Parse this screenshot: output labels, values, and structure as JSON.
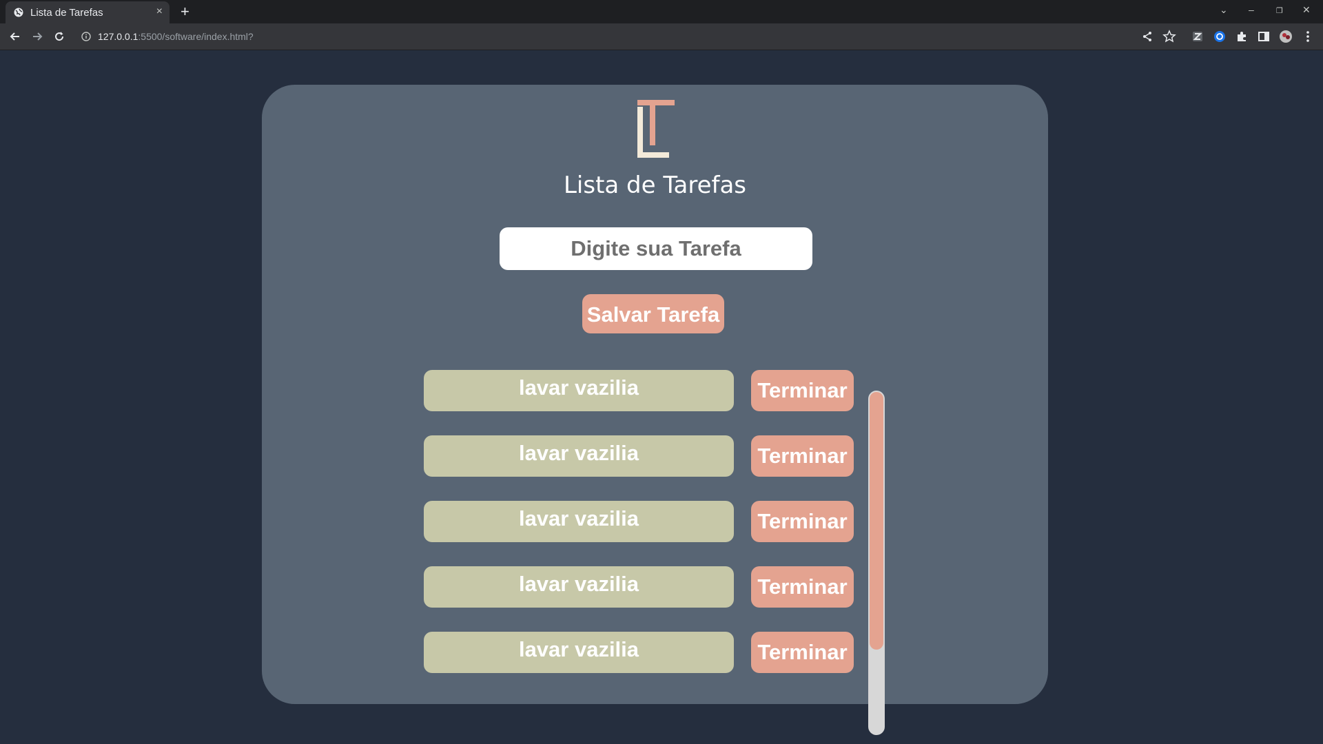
{
  "browser": {
    "tab_title": "Lista de Tarefas",
    "tab_close": "×",
    "new_tab": "+",
    "url_host": "127.0.0.1",
    "url_rest": ":5500/software/index.html?",
    "minimize": "–",
    "restore": "❐",
    "close": "✕",
    "tabs_dropdown": "⌄"
  },
  "app": {
    "title": "Lista de Tarefas",
    "input_placeholder": "Digite sua Tarefa",
    "save_label": "Salvar Tarefa",
    "tasks": [
      {
        "text": "lavar vazilia",
        "action": "Terminar"
      },
      {
        "text": "lavar vazilia",
        "action": "Terminar"
      },
      {
        "text": "lavar vazilia",
        "action": "Terminar"
      },
      {
        "text": "lavar vazilia",
        "action": "Terminar"
      },
      {
        "text": "lavar vazilia",
        "action": "Terminar"
      }
    ],
    "scroll_position": 0
  },
  "colors": {
    "background": "#252e3e",
    "card": "#586574",
    "accent": "#e4a390",
    "task_bg": "#c7c8a8",
    "logo_light": "#f3ead9"
  },
  "icons": [
    "globe-icon",
    "close-icon",
    "plus-icon",
    "back-arrow-icon",
    "forward-arrow-icon",
    "reload-icon",
    "info-icon",
    "share-icon",
    "star-icon",
    "extension-icon",
    "puzzle-icon",
    "sidepanel-icon",
    "profile-avatar-icon",
    "more-menu-icon"
  ]
}
